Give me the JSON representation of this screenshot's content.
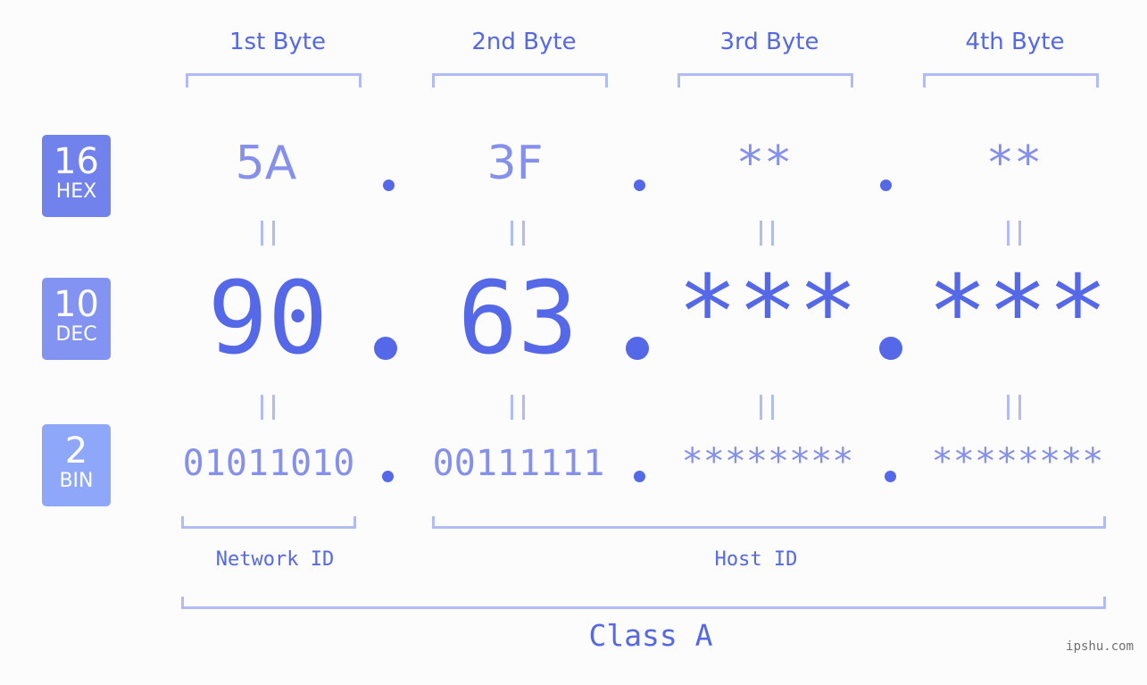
{
  "bytes": [
    {
      "title": "1st Byte",
      "hex": "5A",
      "dec": "90",
      "bin": "01011010"
    },
    {
      "title": "2nd Byte",
      "hex": "3F",
      "dec": "63",
      "bin": "00111111"
    },
    {
      "title": "3rd Byte",
      "hex": "**",
      "dec": "***",
      "bin": "********"
    },
    {
      "title": "4th Byte",
      "hex": "**",
      "dec": "***",
      "bin": "********"
    }
  ],
  "badges": {
    "hex": {
      "num": "16",
      "label": "HEX",
      "color": "#7182ec"
    },
    "dec": {
      "num": "10",
      "label": "DEC",
      "color": "#8393f1"
    },
    "bin": {
      "num": "2",
      "label": "BIN",
      "color": "#8ea7f8"
    }
  },
  "segments": {
    "network": "Network ID",
    "host": "Host ID"
  },
  "class_label": "Class A",
  "watermark": "ipshu.com",
  "colors": {
    "primary": "#5468e8",
    "secondary": "#8490ec",
    "bracket": "#b1bbf4",
    "background": "#fbfcfb"
  }
}
